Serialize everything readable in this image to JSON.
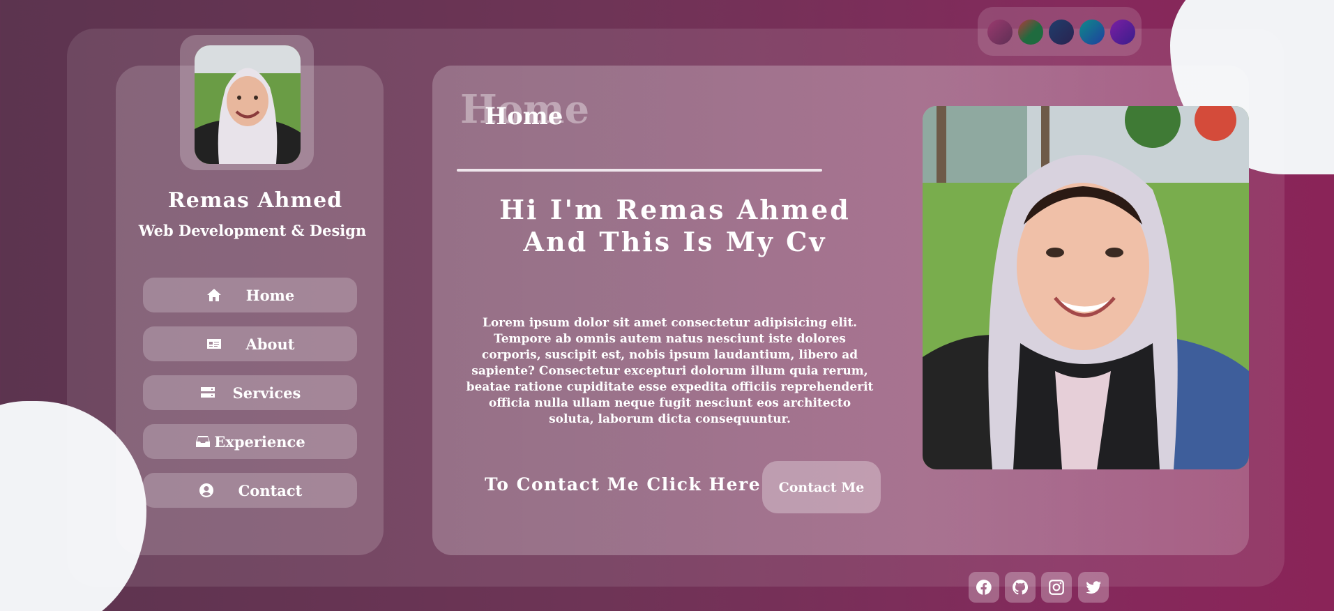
{
  "profile": {
    "name": "Remas Ahmed",
    "role": "Web Development & Design"
  },
  "nav": {
    "items": [
      {
        "label": "Home",
        "icon": "home-icon"
      },
      {
        "label": "About",
        "icon": "id-card-icon"
      },
      {
        "label": "Services",
        "icon": "server-icon"
      },
      {
        "label": "Experience",
        "icon": "inbox-icon"
      },
      {
        "label": "Contact",
        "icon": "user-circle-icon"
      }
    ]
  },
  "main": {
    "section_watermark": "Home",
    "section_title": "Home",
    "hero_text": "Hi I'm Remas Ahmed And This Is My Cv",
    "body_text": "Lorem ipsum dolor sit amet consectetur adipisicing elit. Tempore ab omnis autem natus nesciunt iste dolores corporis, suscipit est, nobis ipsum laudantium, libero ad sapiente? Consectetur excepturi dolorum illum quia rerum, beatae ratione cupiditate esse expedita officiis reprehenderit officia nulla ullam neque fugit nesciunt eos architecto soluta, laborum dicta consequuntur.",
    "contact_prompt": "To Contact Me Click Here",
    "contact_button": "Contact Me"
  },
  "theme_swatches": [
    {
      "name": "swatch-magenta",
      "colors": [
        "#9a3a6e",
        "#5e2f55"
      ]
    },
    {
      "name": "swatch-red-green",
      "colors": [
        "#b23a3a",
        "#1f6b3f"
      ]
    },
    {
      "name": "swatch-navy",
      "colors": [
        "#1f3d6b",
        "#2a2350"
      ]
    },
    {
      "name": "swatch-teal-blue",
      "colors": [
        "#0f8a8a",
        "#1e3f9e"
      ]
    },
    {
      "name": "swatch-purple",
      "colors": [
        "#7a1fa2",
        "#3a1e8c"
      ]
    }
  ],
  "social_links": [
    "facebook-icon",
    "github-icon",
    "instagram-icon",
    "twitter-icon"
  ],
  "colors": {
    "background_start": "#5c344f",
    "background_end": "#8a2458",
    "blob": "#f2f3f6",
    "text": "#ffffff"
  }
}
